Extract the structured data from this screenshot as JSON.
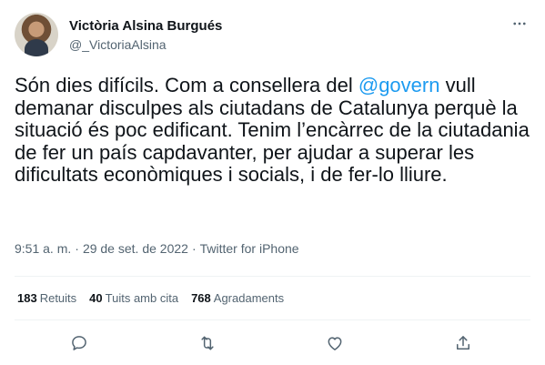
{
  "author": {
    "display_name": "Victòria Alsina Burgués",
    "handle": "@_VictoriaAlsina"
  },
  "more_icon": "more-horizontal-icon",
  "tweet": {
    "text_before_mention": "Són dies difícils. Com a consellera del ",
    "mention": "@govern",
    "text_after_mention": " vull demanar disculpes als ciutadans de Catalunya perquè la situació és poc edificant. Tenim l’encàrrec de la ciutadania de fer un país capdavanter, per ajudar a superar les dificultats econòmiques i socials, i de fer-lo lliure.",
    "time": "9:51 a. m.",
    "date": "29 de set. de 2022",
    "source": "Twitter for iPhone",
    "separator": "·"
  },
  "stats": {
    "retweets_count": "183",
    "retweets_label": "Retuits",
    "quotes_count": "40",
    "quotes_label": "Tuits amb cita",
    "likes_count": "768",
    "likes_label": "Agradaments"
  },
  "actions": [
    "reply-icon",
    "retweet-icon",
    "like-icon",
    "share-icon"
  ],
  "colors": {
    "accent": "#1d9bf0",
    "secondary_text": "#536471",
    "divider": "#eff3f4"
  }
}
